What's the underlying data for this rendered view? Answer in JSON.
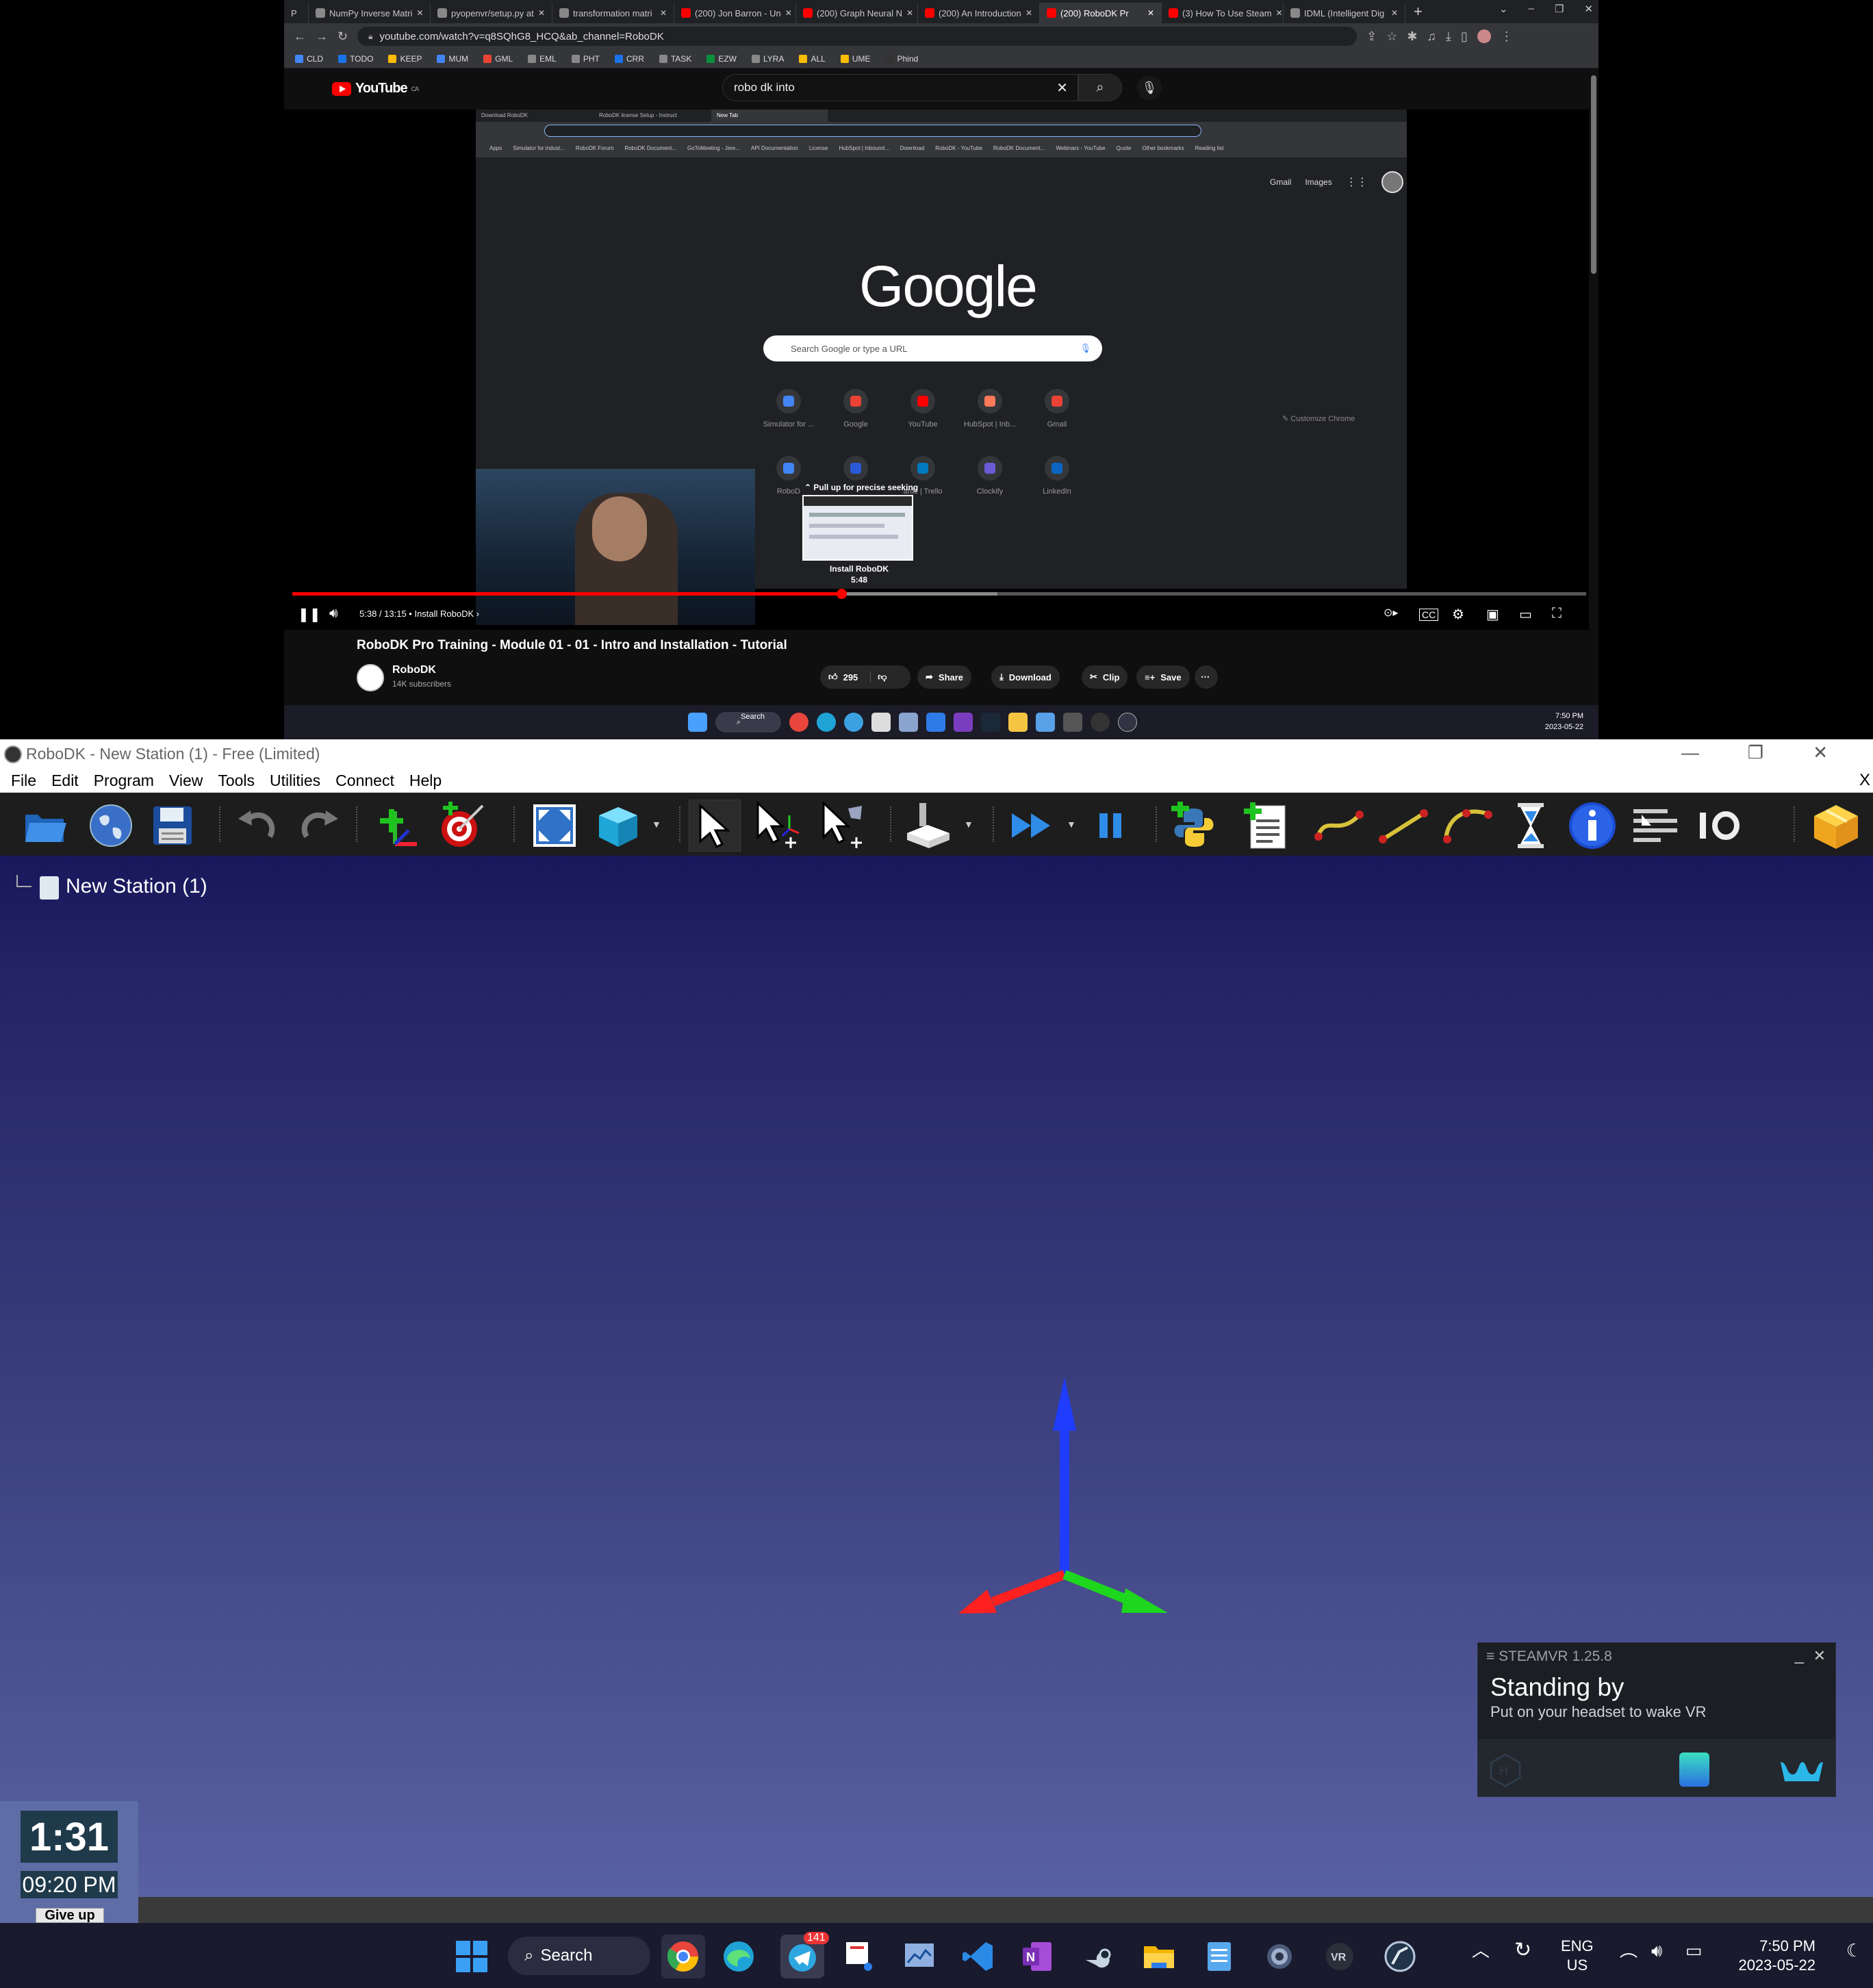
{
  "browser": {
    "tabs": [
      {
        "label": "P",
        "icon": "p-icon"
      },
      {
        "label": "NumPy Inverse Matri"
      },
      {
        "label": "pyopenvr/setup.py at"
      },
      {
        "label": "transformation matri"
      },
      {
        "label": "(200) Jon Barron - Un"
      },
      {
        "label": "(200) Graph Neural N"
      },
      {
        "label": "(200) An Introduction"
      },
      {
        "label": "(200) RoboDK Pr",
        "active": true
      },
      {
        "label": "(3) How To Use Steam"
      },
      {
        "label": "IDML (Intelligent Dig"
      }
    ],
    "url": "youtube.com/watch?v=q8SQhG8_HCQ&ab_channel=RoboDK",
    "bookmarks": [
      {
        "label": "CLD",
        "color": "#4285f4"
      },
      {
        "label": "TODO",
        "color": "#1a73e8"
      },
      {
        "label": "KEEP",
        "color": "#fbbc04"
      },
      {
        "label": "MUM",
        "color": "#4285f4"
      },
      {
        "label": "GML",
        "color": "#ea4335"
      },
      {
        "label": "EML",
        "color": "#888888"
      },
      {
        "label": "PHT",
        "color": "#888888"
      },
      {
        "label": "CRR",
        "color": "#1a73e8"
      },
      {
        "label": "TASK",
        "color": "#888888"
      },
      {
        "label": "EZW",
        "color": "#0a8f3c"
      },
      {
        "label": "LYRA",
        "color": "#888888"
      },
      {
        "label": "ALL",
        "color": "#fbbc04"
      },
      {
        "label": "UME",
        "color": "#fbbc04"
      },
      {
        "label": "Phind",
        "color": "#333333"
      }
    ]
  },
  "youtube": {
    "logo": "YouTube",
    "region": "CA",
    "search_query": "robo dk into",
    "video": {
      "inner_tabs": [
        "Download RoboDK",
        "RoboDK license Setup - Instruct",
        "New Tab"
      ],
      "inner_bookmarks": [
        "Apps",
        "Simulator for indust...",
        "RoboDK Forum",
        "RoboDK Document...",
        "GoToMeeting - Jere...",
        "API Documentation",
        "License",
        "HubSpot | Inbound...",
        "Download",
        "RoboDK - YouTube",
        "RoboDK Document...",
        "Webinars - YouTube",
        "Quote",
        "Other bookmarks",
        "Reading list"
      ],
      "google_links": [
        "Gmail",
        "Images"
      ],
      "google_logo": "Google",
      "google_search_placeholder": "Search Google or type a URL",
      "shortcuts_row1": [
        "Simulator for ...",
        "Google",
        "YouTube",
        "HubSpot | Inb...",
        "Gmail"
      ],
      "shortcuts_row2": [
        "RoboD",
        "",
        "ards | Trello",
        "Clockify",
        "LinkedIn"
      ],
      "seek_hint": "Pull up for precise seeking",
      "seek_chapter": "Install RoboDK",
      "seek_time": "5:48",
      "customize": "Customize Chrome",
      "time": "5:38 / 13:15",
      "chapter": "Install RoboDK",
      "progress_fraction": 0.425,
      "buffered_fraction": 0.545
    },
    "title": "RoboDK Pro Training - Module 01 - 01 - Intro and Installation - Tutorial",
    "channel": "RoboDK",
    "subscribers": "14K subscribers",
    "likes": "295",
    "actions": {
      "share": "Share",
      "download": "Download",
      "clip": "Clip",
      "save": "Save"
    }
  },
  "inner_taskbar": {
    "search": "Search",
    "time": "7:50 PM",
    "date": "2023-05-22"
  },
  "robodk": {
    "title": "RoboDK - New Station (1) - Free (Limited)",
    "menu": [
      "File",
      "Edit",
      "Program",
      "View",
      "Tools",
      "Utilities",
      "Connect",
      "Help"
    ],
    "close_x": "X",
    "station": "New Station (1)",
    "axis_colors": {
      "x": "#ff2020",
      "y": "#1ed61e",
      "z": "#1f3cff"
    }
  },
  "steamvr": {
    "header": "≡ STEAMVR 1.25.8",
    "status": "Standing by",
    "message": "Put on your headset to wake VR"
  },
  "timer": {
    "countdown": "1:31",
    "clock": "09:20 PM",
    "give_up": "Give up"
  },
  "taskbar": {
    "search": "Search",
    "badge": "141",
    "lang1": "ENG",
    "lang2": "US",
    "time": "7:50 PM",
    "date": "2023-05-22"
  }
}
